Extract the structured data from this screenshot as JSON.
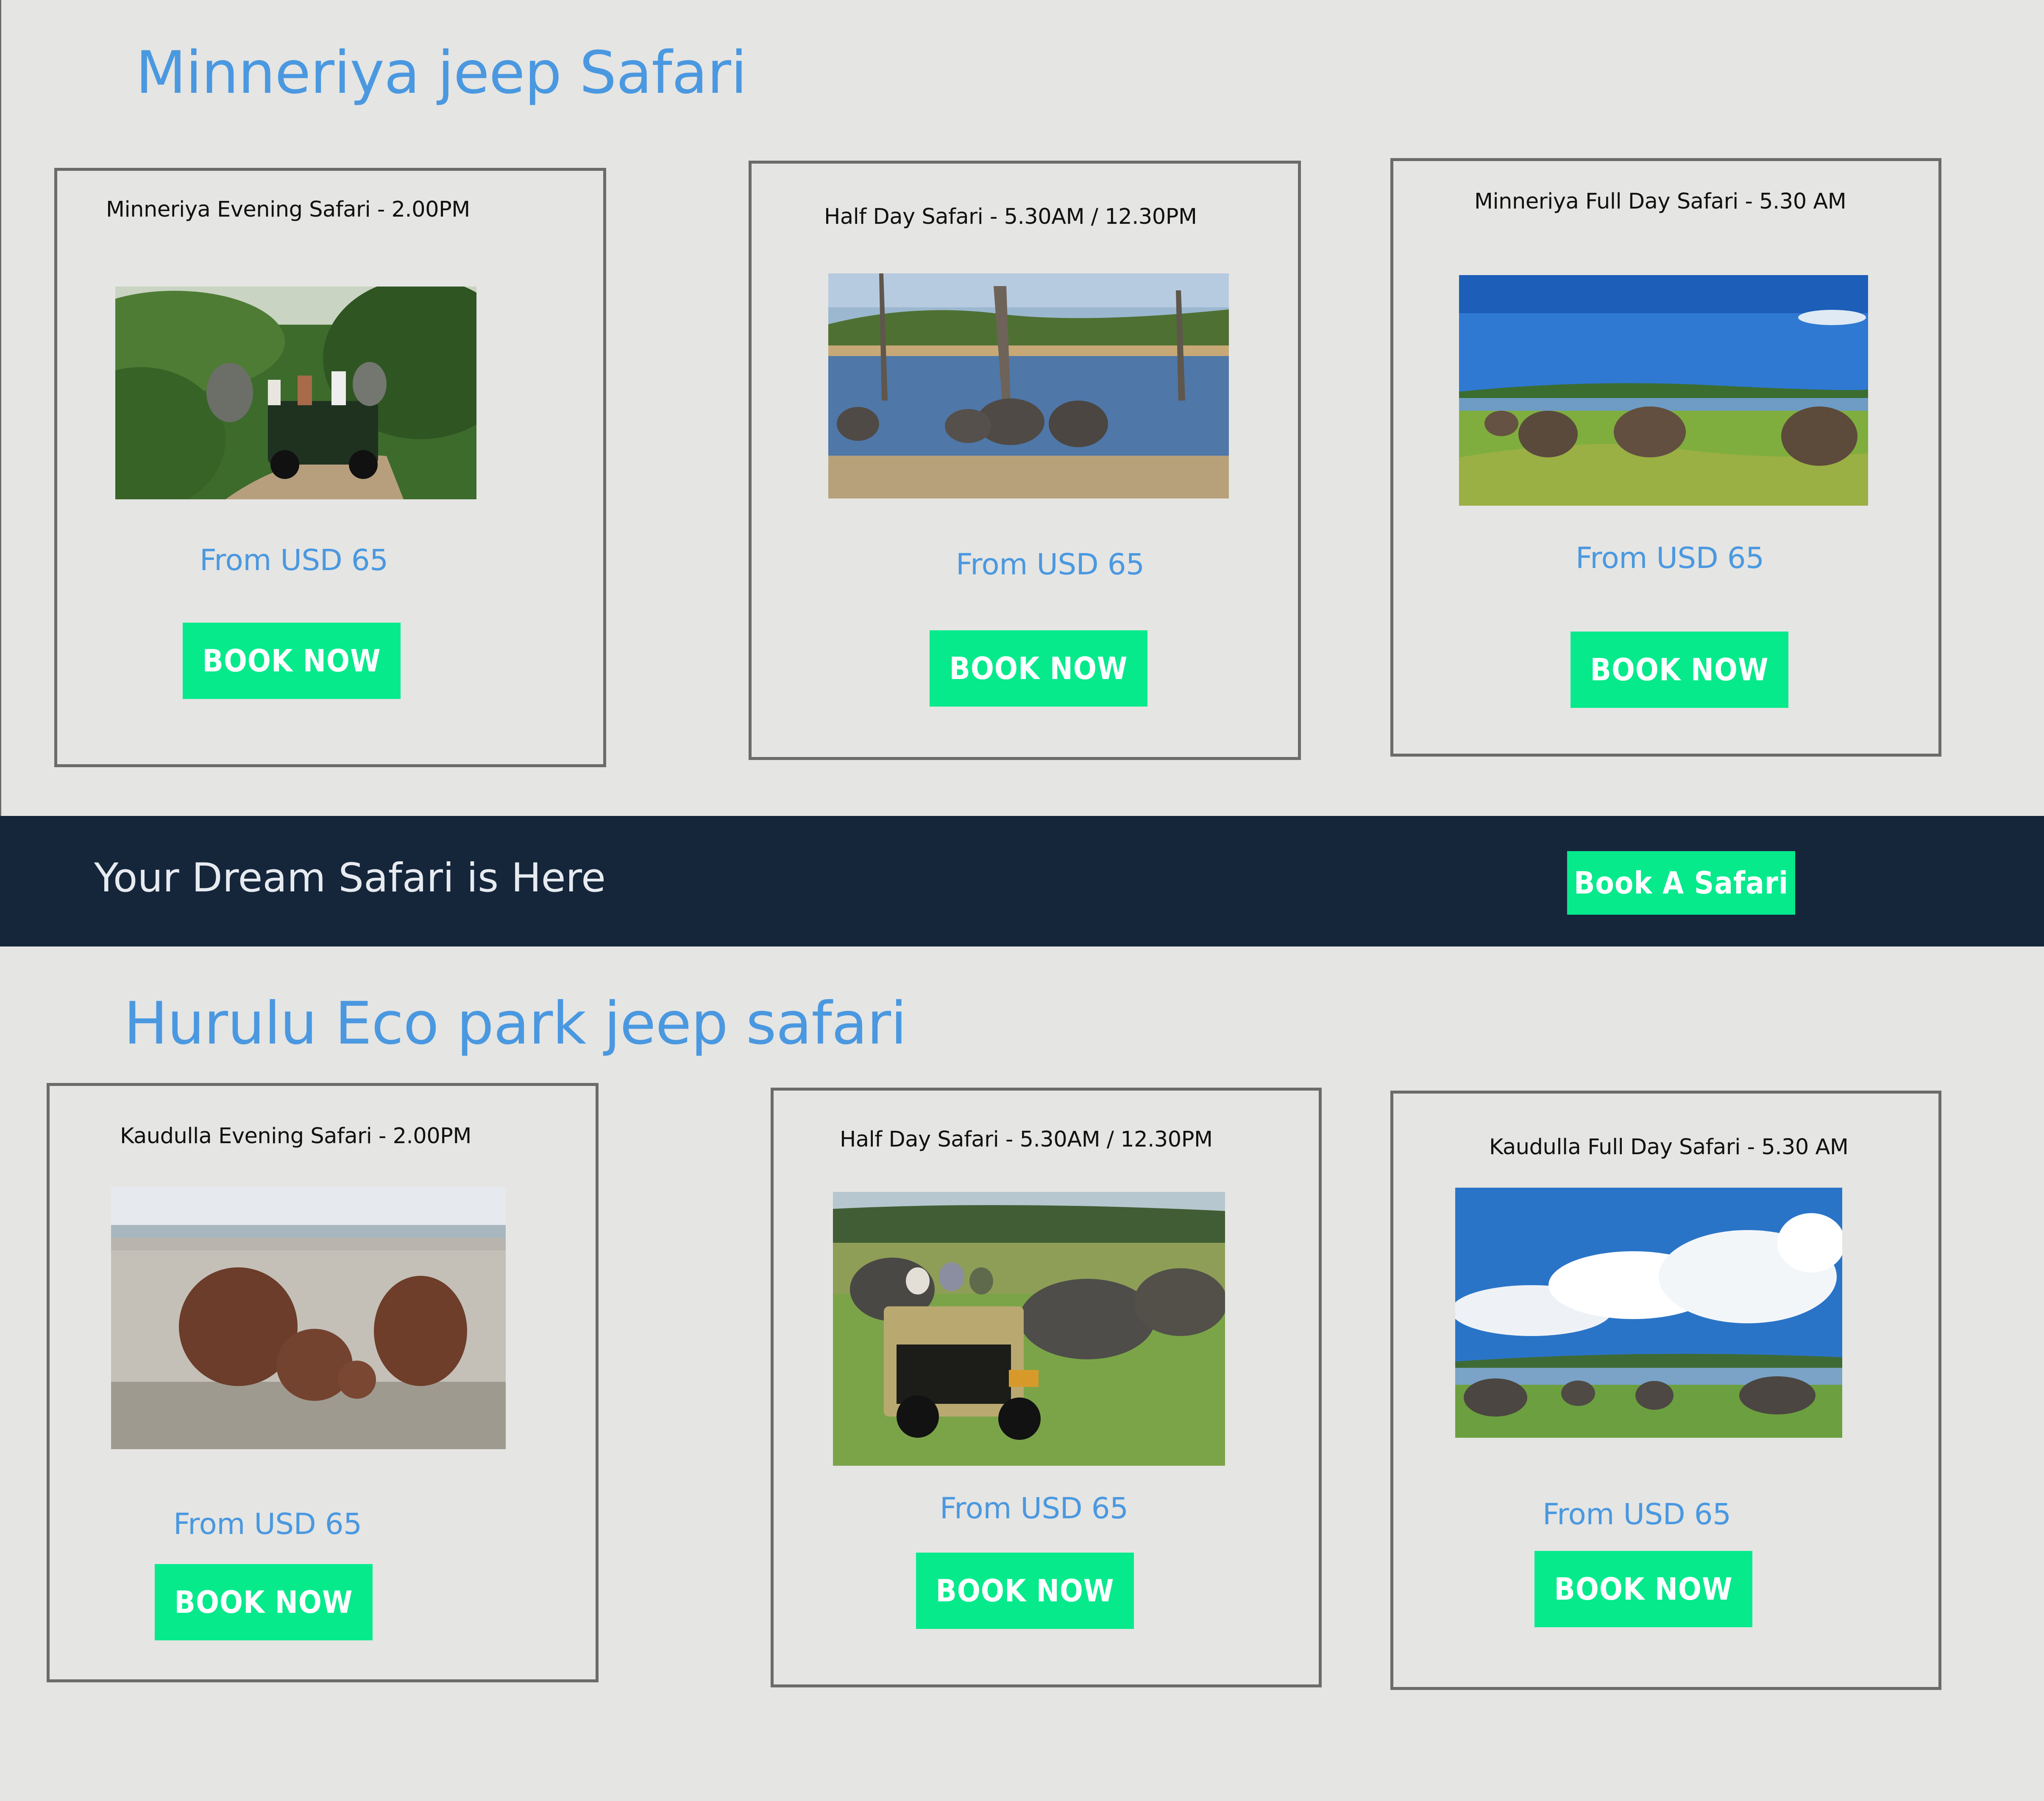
{
  "sections": [
    {
      "title": "Minneriya jeep Safari",
      "cards": [
        {
          "title": "Minneriya Evening Safari - 2.00PM",
          "price": "From USD 65",
          "button": "BOOK NOW"
        },
        {
          "title": "Half Day Safari - 5.30AM / 12.30PM",
          "price": "From USD 65",
          "button": "BOOK NOW"
        },
        {
          "title": "Minneriya Full Day Safari - 5.30 AM",
          "price": "From USD 65",
          "button": "BOOK NOW"
        }
      ]
    },
    {
      "title": "Hurulu Eco park jeep safari",
      "cards": [
        {
          "title": "Kaudulla Evening Safari - 2.00PM",
          "price": "From USD 65",
          "button": "BOOK NOW"
        },
        {
          "title": "Half Day Safari - 5.30AM / 12.30PM",
          "price": "From USD 65",
          "button": "BOOK NOW"
        },
        {
          "title": "Kaudulla Full Day Safari - 5.30 AM",
          "price": "From USD 65",
          "button": "BOOK NOW"
        }
      ]
    }
  ],
  "banner": {
    "text": "Your Dream Safari is Here",
    "button": "Book A Safari"
  },
  "colors": {
    "page_background": "#e5e5e3",
    "accent_blue": "#4a98e0",
    "button_green": "#06ea8c",
    "banner_navy": "#15263b",
    "card_border": "#6b6b6b"
  }
}
